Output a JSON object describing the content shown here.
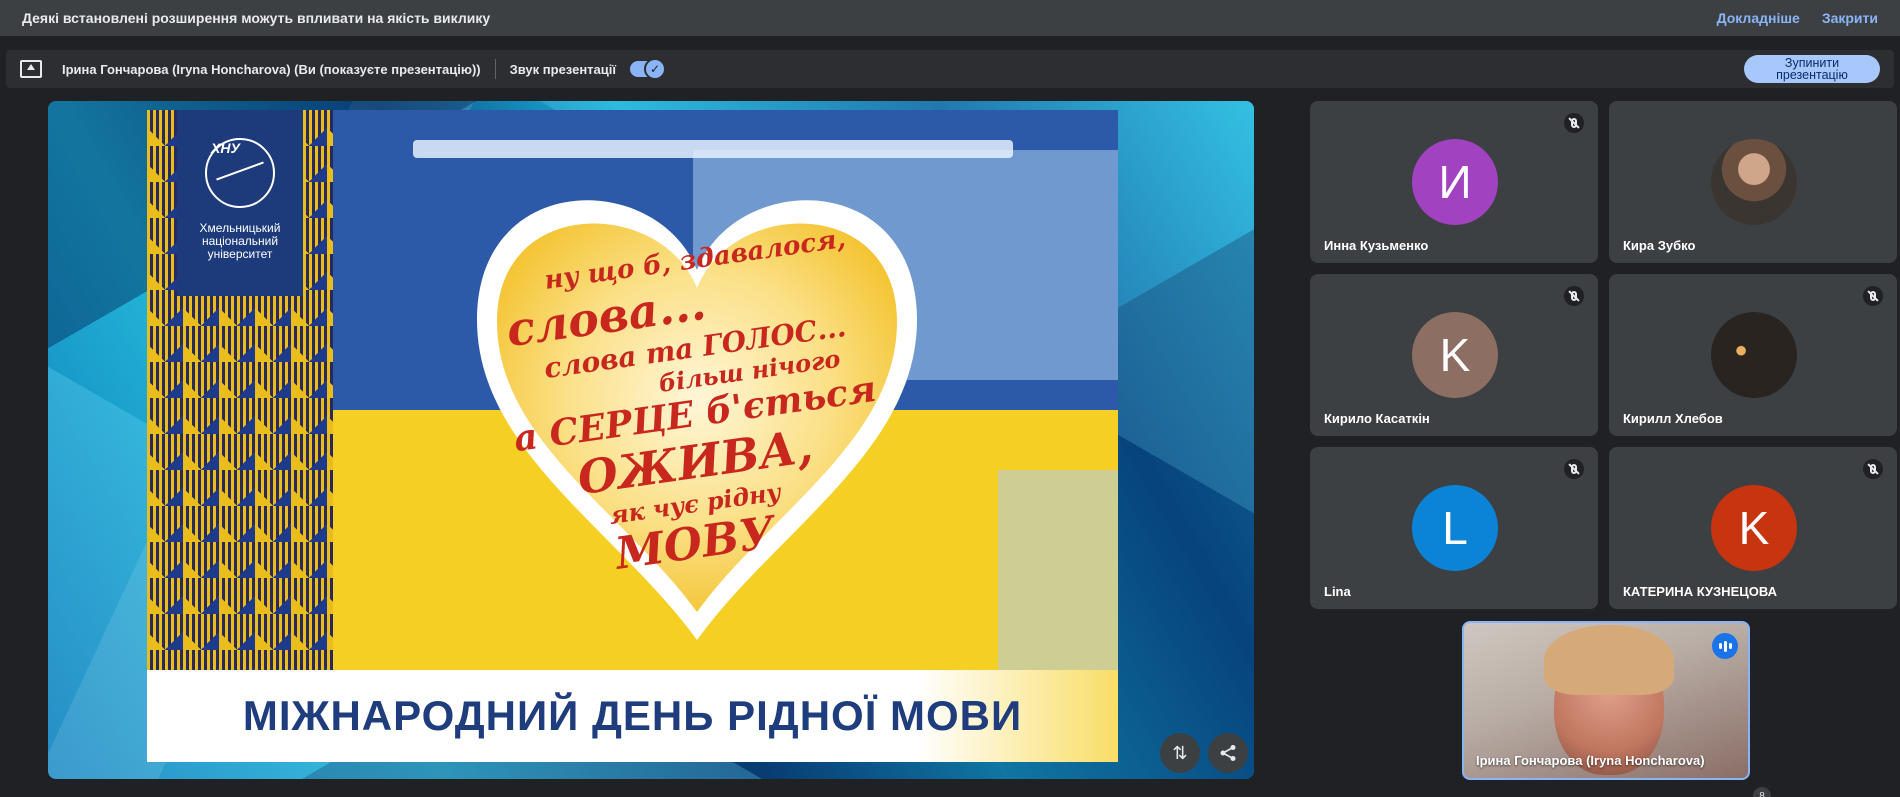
{
  "banner": {
    "message": "Деякі встановлені розширення можуть впливати на якість виклику",
    "details_label": "Докладніше",
    "close_label": "Закрити"
  },
  "presenting_bar": {
    "presenter_text": "Ірина Гончарова (Iryna Honcharova) (Ви (показуєте презентацію))",
    "audio_label": "Звук презентації",
    "audio_enabled": true,
    "stop_button_label": "Зупинити презентацію"
  },
  "slide": {
    "logo_abbr": "ХНУ",
    "logo_text": "Хмельницький національний університет",
    "poem_lines": [
      "ну що б, здавалося,",
      "слова...",
      "слова та ГОЛОС...",
      "більш нічого",
      "а СЕРЦЕ б'ється",
      "ОЖИВА,",
      "як чує рідну",
      "МОВУ"
    ],
    "footer_title": "МІЖНАРОДНИЙ ДЕНЬ РІДНОЇ МОВИ"
  },
  "stage_controls": {
    "switch_icon": "swap-arrows-icon",
    "share_icon": "share-icon"
  },
  "participants": [
    {
      "name": "Инна Кузьменко",
      "initial": "И",
      "color": "#a142c1",
      "muted": true,
      "photo": false
    },
    {
      "name": "Кира Зубко",
      "initial": "",
      "color": "#5a4a3e",
      "muted": false,
      "photo": true
    },
    {
      "name": "Кирило Касаткін",
      "initial": "K",
      "color": "#8d6e63",
      "muted": true,
      "photo": false
    },
    {
      "name": "Кирилл Хлебов",
      "initial": "",
      "color": "#2a2a2a",
      "muted": true,
      "photo": true
    },
    {
      "name": "Lina",
      "initial": "L",
      "color": "#0b84d8",
      "muted": true,
      "photo": false
    },
    {
      "name": "КАТЕРИНА КУЗНЕЦОВА",
      "initial": "K",
      "color": "#c6350f",
      "muted": true,
      "photo": false
    }
  ],
  "self_view": {
    "name": "Ірина Гончарова (Iryna Honcharova)",
    "speaking": true
  },
  "participant_count": "8",
  "colors": {
    "banner_bg": "#3c4043",
    "accent": "#8ab4f8",
    "stop_button_bg": "#a8c7fa"
  }
}
